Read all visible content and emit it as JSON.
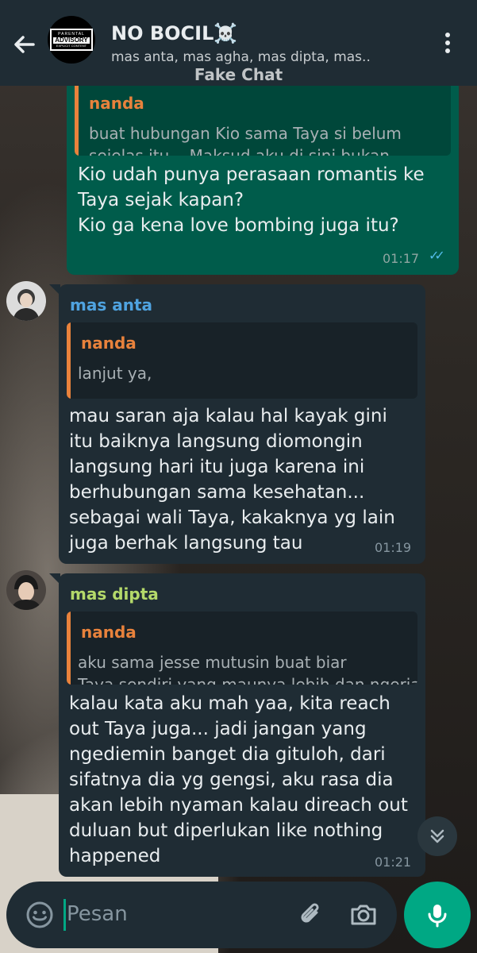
{
  "header": {
    "title": "NO BOCIL☠️",
    "subtitle": "mas anta, mas agha, mas dipta, mas..",
    "watermark": "Fake Chat",
    "avatar_label": {
      "top": "PARENTAL",
      "middle": "ADVISORY",
      "bottom": "EXPLICIT CONTENT"
    }
  },
  "messages": {
    "outgoing": {
      "quote_author": "nanda",
      "quote_text": "buat hubungan Kio sama Taya si belum",
      "quote_text_cut": "sejelas itu... Maksud aku di sini bukan",
      "lines": [
        "Kio udah punya perasaan romantis ke",
        "Taya sejak kapan?",
        "Kio ga kena love bombing juga itu?"
      ],
      "time": "01:17"
    },
    "anta": {
      "sender": "mas anta",
      "sender_color": "#4fa3e0",
      "quote_author": "nanda",
      "quote_text": "lanjut ya,",
      "lines": [
        "mau saran aja kalau hal kayak gini",
        "itu baiknya langsung diomongin",
        "langsung hari itu juga karena ini",
        "berhubungan sama kesehatan...",
        "sebagai wali Taya, kakaknya yg lain",
        "juga berhak langsung tau"
      ],
      "time": "01:19"
    },
    "dipta": {
      "sender": "mas dipta",
      "sender_color": "#b4d96a",
      "quote_author": "nanda",
      "quote_text": "aku sama jesse mutusin buat biar",
      "quote_text_cut": "Taya sendiri yang maunya lebih dan ngerjain",
      "lines": [
        "kalau kata aku mah yaa, kita reach",
        "out Taya juga... jadi jangan yang",
        "ngediemin banget dia gituloh, dari",
        "sifatnya dia yg gengsi, aku rasa dia",
        "akan lebih nyaman kalau direach out",
        "duluan but diperlukan like nothing",
        "happened"
      ],
      "time": "01:21"
    }
  },
  "input": {
    "placeholder": "Pesan"
  },
  "icons": [
    "back-arrow-icon",
    "more-vert-icon",
    "emoji-icon",
    "attach-icon",
    "camera-icon",
    "mic-icon",
    "chevron-double-down-icon",
    "double-check-icon"
  ],
  "colors": {
    "header": "#1f2c34",
    "outgoing": "#005c4b",
    "incoming": "#1f2c34",
    "accent": "#00a884",
    "quote": "#e8823c"
  }
}
